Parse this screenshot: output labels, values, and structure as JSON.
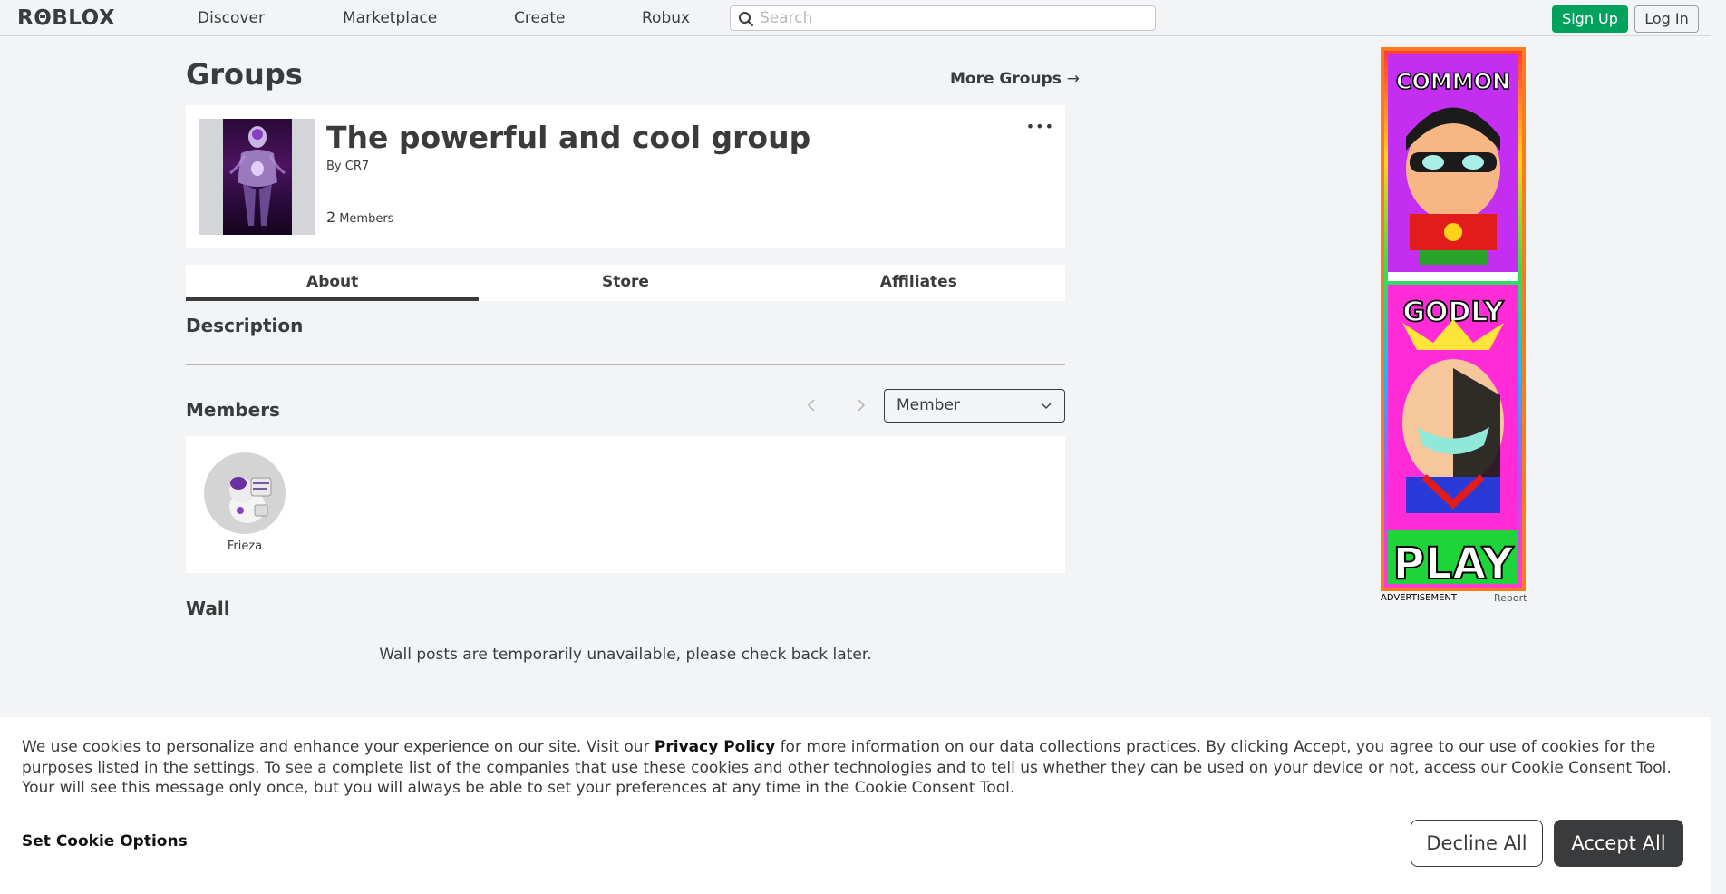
{
  "header": {
    "logo": "RΘBLOX",
    "nav": [
      "Discover",
      "Marketplace",
      "Create",
      "Robux"
    ],
    "search_placeholder": "Search",
    "signup_label": "Sign Up",
    "login_label": "Log In"
  },
  "page": {
    "title": "Groups",
    "more_groups": "More Groups"
  },
  "group": {
    "name": "The powerful and cool group",
    "by_prefix": "By",
    "owner": "CR7",
    "member_count": "2",
    "member_label": "Members",
    "more_menu": "•••"
  },
  "tabs": [
    {
      "label": "About",
      "active": true
    },
    {
      "label": "Store",
      "active": false
    },
    {
      "label": "Affiliates",
      "active": false
    }
  ],
  "sections": {
    "description": "Description",
    "members": "Members",
    "wall": "Wall"
  },
  "members": {
    "role_selected": "Member",
    "list": [
      {
        "username": "Frieza"
      }
    ]
  },
  "wall": {
    "message": "Wall posts are temporarily unavailable, please check back later."
  },
  "ad": {
    "top_text": "COMMON",
    "mid_text": "GODLY",
    "bottom_text": "PLAY",
    "label": "ADVERTISEMENT",
    "report": "Report"
  },
  "cookie": {
    "text_before": "We use cookies to personalize and enhance your experience on our site. Visit our ",
    "privacy_link": "Privacy Policy",
    "text_after": " for more information on our data collections practices. By clicking Accept, you agree to our use of cookies for the purposes listed in the settings. To see a complete list of the companies that use these cookies and other technologies and to tell us whether they can be used on your device or not, access our Cookie Consent Tool. Your will see this message only once, but you will always be able to set your preferences at any time in the Cookie Consent Tool.",
    "set_options": "Set Cookie Options",
    "decline": "Decline All",
    "accept": "Accept All"
  }
}
